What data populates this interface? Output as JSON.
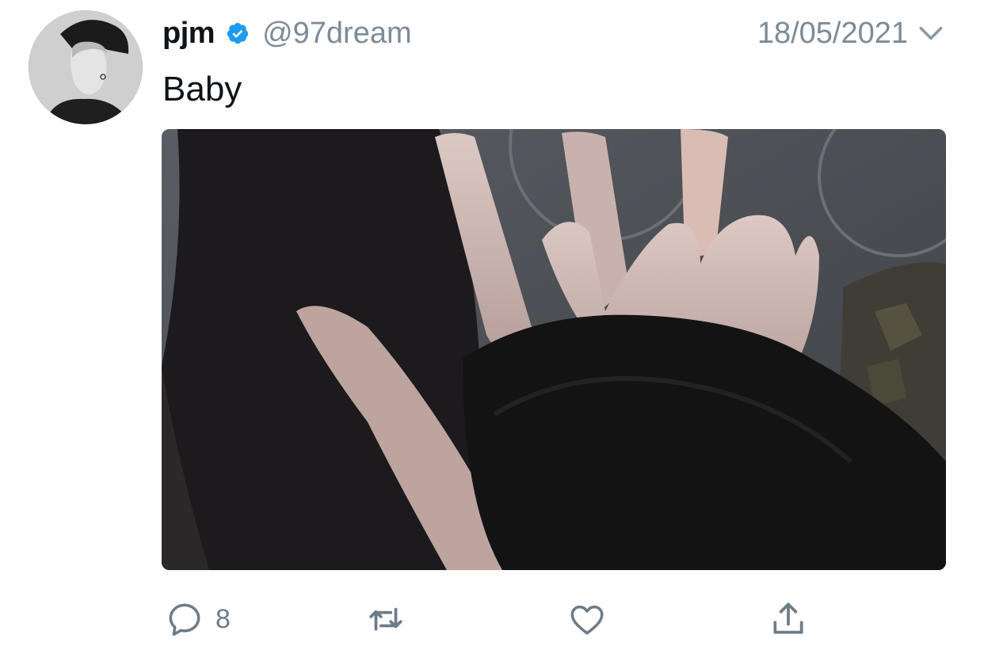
{
  "tweet": {
    "author": {
      "display_name": "pjm",
      "handle": "@97dream",
      "verified": true,
      "avatar_icon": "avatar-photo"
    },
    "date": "18/05/2021",
    "text": "Baby",
    "media": {
      "type": "photo"
    },
    "actions": {
      "reply_count": "8",
      "retweet_count": "",
      "like_count": "",
      "icons": {
        "reply": "reply-icon",
        "retweet": "retweet-icon",
        "like": "heart-icon",
        "share": "share-icon",
        "menu": "chevron-down-icon"
      }
    },
    "colors": {
      "verified": "#1d9bf0",
      "secondary_text": "#7d8b98",
      "icon": "#6e7c88"
    }
  }
}
